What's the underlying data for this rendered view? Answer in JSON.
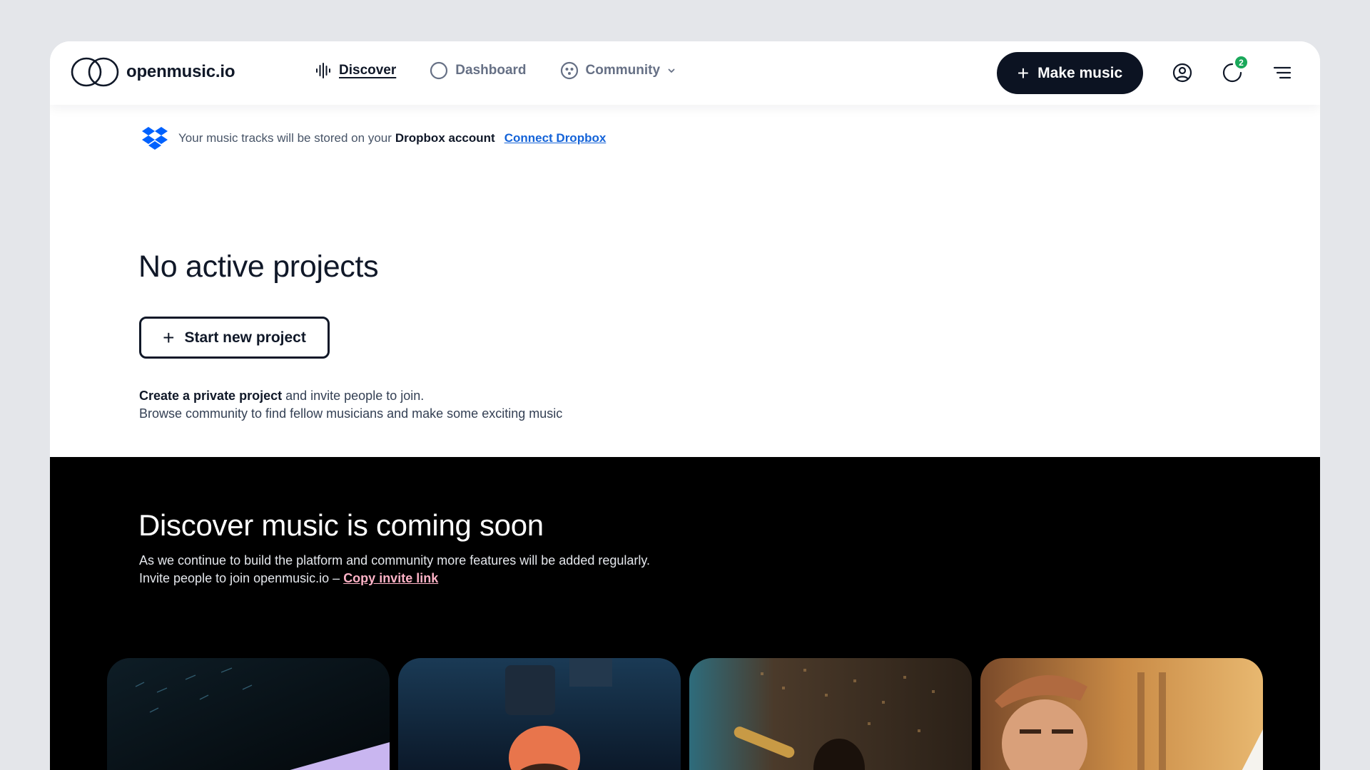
{
  "brand": {
    "name": "openmusic.io"
  },
  "nav": {
    "items": [
      {
        "label": "Discover",
        "icon": "waveform-icon",
        "active": true
      },
      {
        "label": "Dashboard",
        "icon": "circle-icon",
        "active": false
      },
      {
        "label": "Community",
        "icon": "community-icon",
        "active": false,
        "dropdown": true
      }
    ]
  },
  "header": {
    "make_music_label": "Make music",
    "notification_count": "2",
    "icons": [
      "user-icon",
      "notifications-icon",
      "menu-icon"
    ]
  },
  "notice": {
    "text": "Your music tracks will be stored on your",
    "bold": "Dropbox account",
    "link": "Connect Dropbox"
  },
  "empty_state": {
    "title": "No active projects",
    "button_label": "Start new project",
    "desc_bold": "Create a private project",
    "desc_rest": " and invite people to join.",
    "desc_line2": "Browse community to find fellow musicians and make some exciting music"
  },
  "discover": {
    "title": "Discover music is coming soon",
    "line1": "As we continue to build the platform and community more features will be added regularly.",
    "line2": "Invite people to join openmusic.io – ",
    "link": "Copy invite link",
    "cards": [
      "card-1",
      "card-2",
      "card-3",
      "card-4"
    ]
  },
  "colors": {
    "accent_dark": "#0c1322",
    "link_blue": "#1463d8",
    "badge_green": "#1aa85a",
    "invite_pink": "#ffb3c7",
    "dropbox_blue": "#0061fe"
  }
}
